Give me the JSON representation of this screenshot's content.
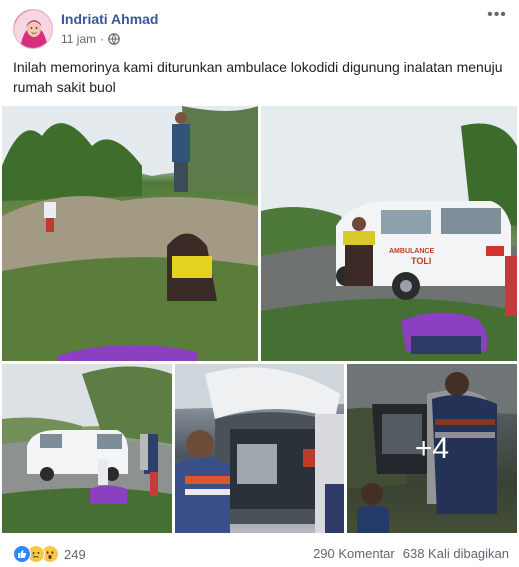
{
  "header": {
    "author": "Indriati Ahmad",
    "time": "11 jam",
    "separator": "·",
    "more_label": "•••"
  },
  "post": {
    "caption": "Inilah memorinya kami diturunkan ambulace lokodidi digunung inalatan menuju rumah sakit buol"
  },
  "photos": {
    "ambulance_text": "AMBULANCE\nTOLI",
    "more_count": "+4"
  },
  "footer": {
    "reaction_count": "249",
    "comments": "290 Komentar",
    "shares": "638 Kali dibagikan",
    "reaction_icons": [
      "like-icon",
      "sad-icon",
      "wow-icon"
    ]
  },
  "colors": {
    "author": "#385898",
    "like": "#2d88ff",
    "emoji": "#f7c844"
  }
}
